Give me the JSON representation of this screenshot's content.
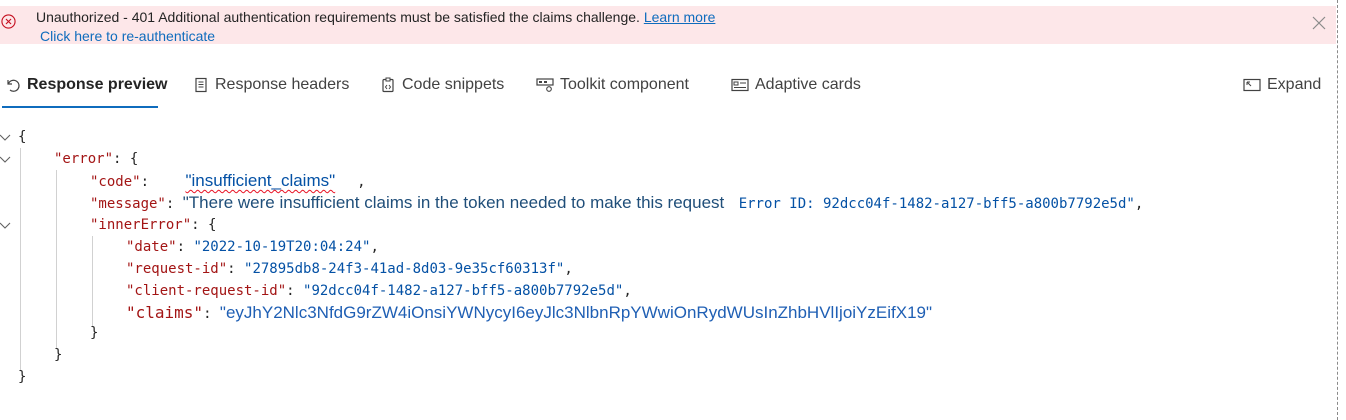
{
  "banner": {
    "message": "Unauthorized - 401 Additional authentication requirements must be satisfied the claims challenge.",
    "learn_more": "Learn more",
    "reauth": "Click here to re-authenticate"
  },
  "tabs": [
    {
      "label": "Response preview",
      "icon": "undo-arrow-icon",
      "active": true
    },
    {
      "label": "Response headers",
      "icon": "document-list-icon",
      "active": false
    },
    {
      "label": "Code snippets",
      "icon": "code-clipboard-icon",
      "active": false
    },
    {
      "label": "Toolkit component",
      "icon": "toolkit-icon",
      "active": false
    },
    {
      "label": "Adaptive cards",
      "icon": "card-icon",
      "active": false
    }
  ],
  "expand_label": "Expand",
  "json": {
    "open_brace": "{",
    "close_brace": "}",
    "error_key": "\"error\"",
    "code_key": "\"code\"",
    "code_value": "\"insufficient_claims\"",
    "message_key": "\"message\"",
    "message_value": "\"There were insufficient claims in the token needed to make this request",
    "error_id": "Error ID: 92dcc04f-1482-a127-bff5-a800b7792e5d\"",
    "inner_error_key": "\"innerError\"",
    "date_key": "\"date\"",
    "date_value": "\"2022-10-19T20:04:24\"",
    "request_id_key": "\"request-id\"",
    "request_id_value": "\"27895db8-24f3-41ad-8d03-9e35cf60313f\"",
    "client_request_id_key": "\"client-request-id\"",
    "client_request_id_value": "\"92dcc04f-1482-a127-bff5-a800b7792e5d\"",
    "claims_key": "\"claims\"",
    "claims_value": "\"eyJhY2Nlc3NfdG9rZW4iOnsiYWNycyI6eyJlc3NlbnRpYWwiOnRydWUsInZhbHVlIjoiYzEifX19\""
  },
  "colors": {
    "banner_bg": "#fde7e9",
    "accent": "#0f6cbd",
    "json_key": "#a31515",
    "json_string": "#0451a5"
  }
}
